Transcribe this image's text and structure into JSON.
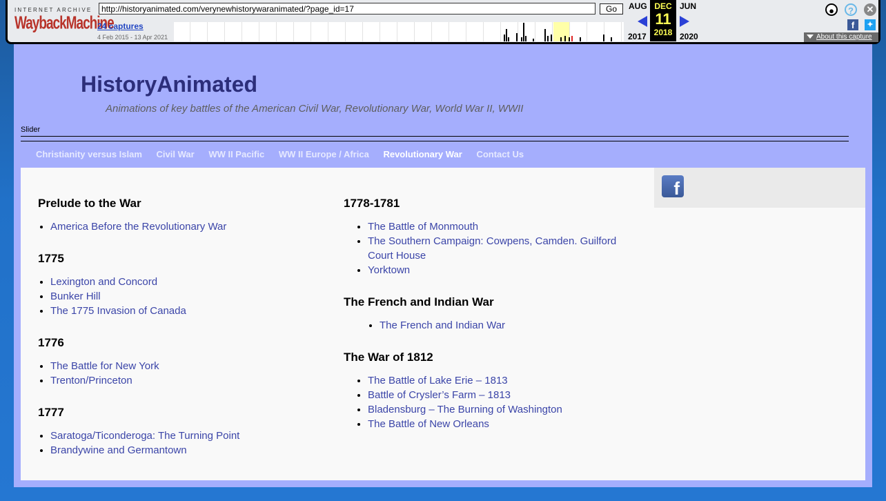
{
  "wayback": {
    "logo_top": "INTERNET ARCHIVE",
    "logo_main": "WaybackMachine",
    "url": "http://historyanimated.com/verynewhistorywaranimated/?page_id=17",
    "go_label": "Go",
    "captures": "24 captures",
    "date_range": "4 Feb 2015 - 13 Apr 2021",
    "prev_month": "AUG",
    "prev_year": "2017",
    "cur_month": "DEC",
    "cur_day": "11",
    "cur_year": "2018",
    "next_month": "JUN",
    "next_year": "2020",
    "about": "About this capture"
  },
  "site": {
    "title": "HistoryAnimated",
    "description": "Animations of key battles of the American Civil War, Revolutionary War, World War II, WWII",
    "slider_label": "Slider",
    "nav": [
      "Christianity versus Islam",
      "Civil War",
      "WW II Pacific",
      "WW II Europe / Africa",
      "Revolutionary War",
      "Contact Us"
    ]
  },
  "sections": {
    "prelude": {
      "heading": "Prelude to the War",
      "items": [
        "America Before the Revolutionary War"
      ]
    },
    "y1775": {
      "heading": "1775",
      "items": [
        "Lexington and Concord",
        "Bunker Hill",
        "The 1775 Invasion of Canada"
      ]
    },
    "y1776": {
      "heading": "1776",
      "items": [
        "The Battle for New York",
        "Trenton/Princeton"
      ]
    },
    "y1777": {
      "heading": "1777",
      "items": [
        "Saratoga/Ticonderoga: The Turning Point",
        "Brandywine and Germantown"
      ]
    },
    "y1778": {
      "heading": "1778-1781",
      "items": [
        "The Battle of Monmouth",
        "The Southern Campaign: Cowpens, Camden. Guilford Court House",
        "Yorktown"
      ]
    },
    "french": {
      "heading": "The French and Indian War",
      "items": [
        "The French and Indian War"
      ]
    },
    "war1812": {
      "heading": "The War of 1812",
      "items": [
        "The Battle of Lake Erie – 1813",
        "Battle of Crysler’s Farm – 1813",
        "Bladensburg – The Burning of Washington",
        "The Battle of New Orleans"
      ]
    }
  },
  "icons": {
    "facebook": "facebook-icon",
    "twitter": "twitter-icon",
    "user": "user-icon",
    "help": "help-icon",
    "close": "close-icon"
  }
}
